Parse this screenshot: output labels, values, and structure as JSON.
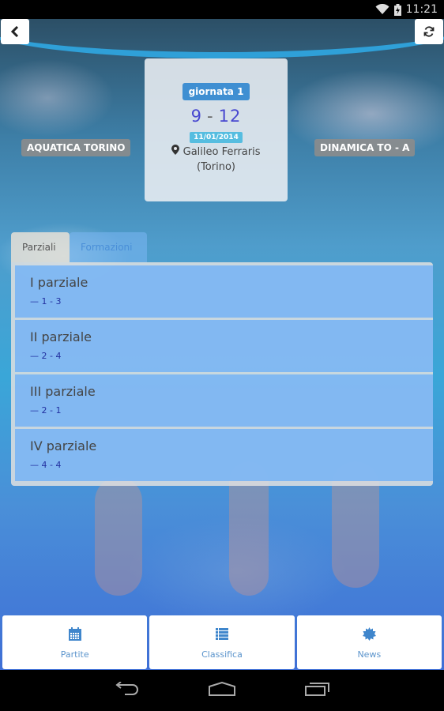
{
  "status_bar": {
    "time": "11:21",
    "icons": [
      "wifi-icon",
      "battery-charging-icon"
    ]
  },
  "header": {
    "back_icon": "chevron-left-icon",
    "refresh_icon": "refresh-icon"
  },
  "match": {
    "round_label": "giornata 1",
    "home_score": "9",
    "separator": "-",
    "away_score": "12",
    "date": "11/01/2014",
    "venue_icon": "map-marker-icon",
    "venue_name": "Galileo Ferraris",
    "venue_city": "(Torino)",
    "home_team": "AQUATICA TORINO",
    "away_team": "DINAMICA TO - A"
  },
  "tabs": [
    {
      "label": "Parziali",
      "active": true
    },
    {
      "label": "Formazioni",
      "active": false
    }
  ],
  "partials": [
    {
      "title": "I parziale",
      "score": "— 1 - 3"
    },
    {
      "title": "II parziale",
      "score": "— 2 - 4"
    },
    {
      "title": "III parziale",
      "score": "— 2 - 1"
    },
    {
      "title": "IV parziale",
      "score": "— 4 - 4"
    }
  ],
  "bottom_nav": [
    {
      "label": "Partite",
      "icon": "calendar-icon"
    },
    {
      "label": "Classifica",
      "icon": "list-icon"
    },
    {
      "label": "News",
      "icon": "certificate-icon"
    }
  ],
  "colors": {
    "accent": "#3f8fd2",
    "score": "#4848d0",
    "date_badge": "#56bde0",
    "partial_bg": "#78b4f5",
    "nav_text": "#5b94cc"
  }
}
